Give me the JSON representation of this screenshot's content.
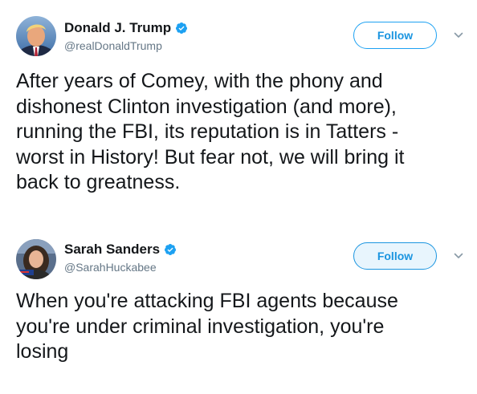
{
  "tweets": [
    {
      "display_name": "Donald J. Trump",
      "handle": "@realDonaldTrump",
      "verified": true,
      "follow_label": "Follow",
      "text": "After years of Comey, with the phony and\ndishonest Clinton investigation (and more),\nrunning the FBI, its reputation is in Tatters -\nworst in History! But fear not, we will bring it\nback to greatness."
    },
    {
      "display_name": "Sarah Sanders",
      "handle": "@SarahHuckabee",
      "verified": true,
      "follow_label": "Follow",
      "text": "When you're attacking FBI agents because\nyou're under criminal investigation, you're\nlosing"
    }
  ],
  "colors": {
    "accent": "#1da1f2",
    "text": "#14171a",
    "secondary_text": "#657786",
    "verified_badge": "#1da1f2"
  },
  "icons": [
    "verified-badge-icon",
    "chevron-down-icon"
  ]
}
